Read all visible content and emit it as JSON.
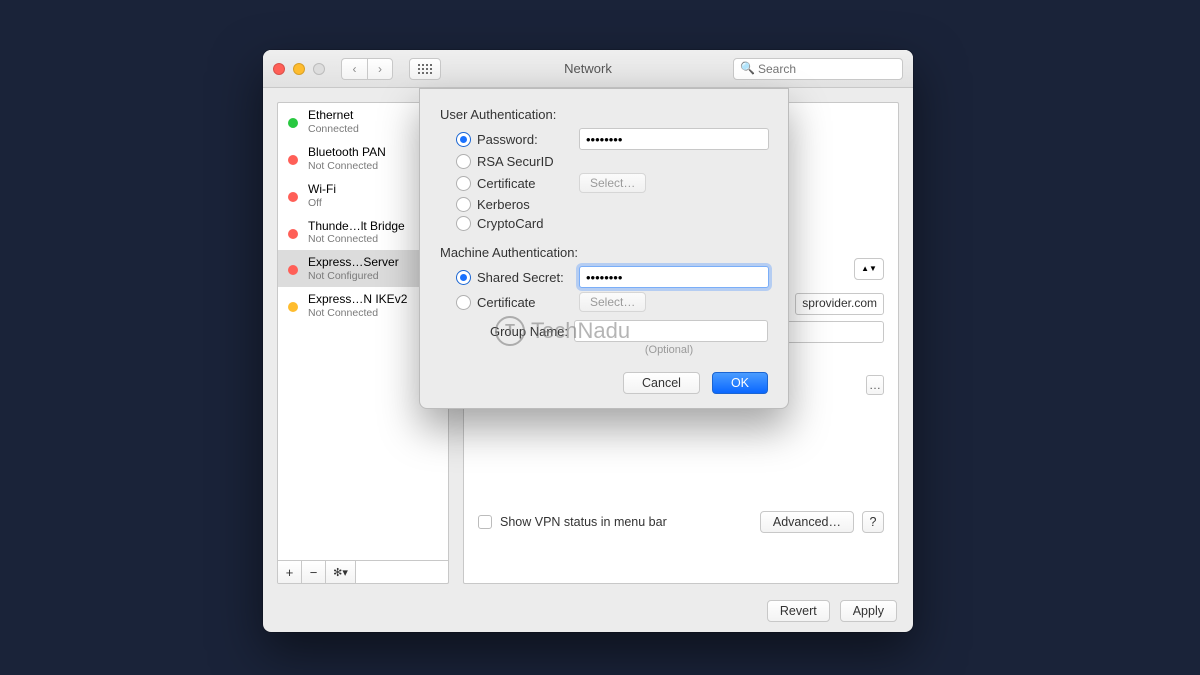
{
  "window": {
    "title": "Network",
    "search_placeholder": "Search"
  },
  "sidebar": {
    "items": [
      {
        "name": "Ethernet",
        "status": "Connected",
        "color": "green"
      },
      {
        "name": "Bluetooth PAN",
        "status": "Not Connected",
        "color": "red"
      },
      {
        "name": "Wi-Fi",
        "status": "Off",
        "color": "red"
      },
      {
        "name": "Thunde…lt Bridge",
        "status": "Not Connected",
        "color": "red"
      },
      {
        "name": "Express…Server",
        "status": "Not Configured",
        "color": "red"
      },
      {
        "name": "Express…N IKEv2",
        "status": "Not Connected",
        "color": "yellow"
      }
    ],
    "selected_index": 4,
    "footer_add": "+",
    "footer_remove": "−",
    "footer_gear": "✻▾"
  },
  "detail": {
    "server_peek": "sprovider.com",
    "authsettings_peek": "…",
    "show_vpn_label": "Show VPN status in menu bar",
    "advanced_label": "Advanced…",
    "help_label": "?"
  },
  "bottom": {
    "revert": "Revert",
    "apply": "Apply"
  },
  "sheet": {
    "user_auth_label": "User Authentication:",
    "machine_auth_label": "Machine Authentication:",
    "options": {
      "password_label": "Password:",
      "password_value": "••••••••",
      "rsa_label": "RSA SecurID",
      "cert_label": "Certificate",
      "select_label": "Select…",
      "kerberos_label": "Kerberos",
      "crypto_label": "CryptoCard",
      "shared_label": "Shared Secret:",
      "shared_value": "••••••••",
      "machine_cert_label": "Certificate"
    },
    "group_label": "Group Name:",
    "group_value": "",
    "optional": "(Optional)",
    "cancel": "Cancel",
    "ok": "OK"
  },
  "watermark": "TechNadu"
}
